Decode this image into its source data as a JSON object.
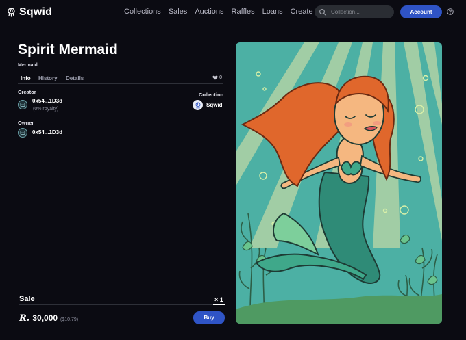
{
  "header": {
    "brand": "Sqwid",
    "nav_links": [
      "Collections",
      "Sales",
      "Auctions",
      "Raffles",
      "Loans",
      "Create"
    ],
    "search_placeholder": "Collection...",
    "account_label": "Account"
  },
  "item": {
    "title": "Spirit Mermaid",
    "collection_link": "Mermaid",
    "tabs": [
      "Info",
      "History",
      "Details"
    ],
    "active_tab": "Info",
    "likes": "0",
    "creator_label": "Creator",
    "creator_address": "0x54...1D3d",
    "creator_royalty": "(0% royalty)",
    "owner_label": "Owner",
    "owner_address": "0x54...1D3d",
    "collection_label": "Collection",
    "collection_name": "Sqwid"
  },
  "sale": {
    "title": "Sale",
    "quantity": "× 1",
    "currency_symbol": "R.",
    "price": "30,000",
    "price_usd": "($10.79)",
    "buy_label": "Buy"
  },
  "colors": {
    "background": "#0b0b12",
    "accent": "#2f54c6",
    "art_teal": "#4fb3a6"
  }
}
